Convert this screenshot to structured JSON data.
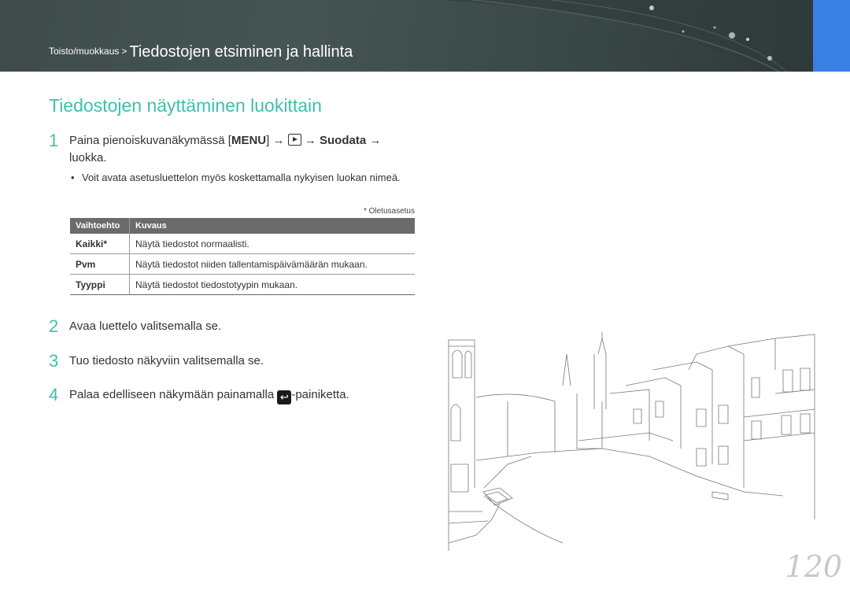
{
  "header": {
    "breadcrumb_parent": "Toisto/muokkaus",
    "breadcrumb_separator": ">",
    "breadcrumb_current": "Tiedostojen etsiminen ja hallinta"
  },
  "section_title": "Tiedostojen näyttäminen luokittain",
  "step1": {
    "number": "1",
    "text_before": "Paina pienoiskuvanäkymässä [",
    "menu_key": "MENU",
    "text_after_key": "] → ",
    "arrow": " → ",
    "bold_item": "Suodata",
    "text_end": " → luokka.",
    "play_icon": "play-icon"
  },
  "bullet": {
    "symbol": "•",
    "text": "Voit avata asetusluettelon myös koskettamalla nykyisen luokan nimeä."
  },
  "default_note": "* Oletusasetus",
  "options_table": {
    "headers": [
      "Vaihtoehto",
      "Kuvaus"
    ],
    "rows": [
      {
        "option": "Kaikki*",
        "description": "Näytä tiedostot normaalisti."
      },
      {
        "option": "Pvm",
        "description": "Näytä tiedostot niiden tallentamispäivämäärän mukaan."
      },
      {
        "option": "Tyyppi",
        "description": "Näytä tiedostot tiedostotyypin mukaan."
      }
    ]
  },
  "step2": {
    "number": "2",
    "text": "Avaa luettelo valitsemalla se."
  },
  "step3": {
    "number": "3",
    "text": "Tuo tiedosto näkyviin valitsemalla se."
  },
  "step4": {
    "number": "4",
    "text_before": "Palaa edelliseen näkymään painamalla ",
    "text_after": "-painiketta.",
    "icon": "back-icon",
    "icon_glyph": "↩"
  },
  "page_number": "120",
  "colors": {
    "accent": "#3fbfa9",
    "header": "#404c4c",
    "tab": "#3a7fe4",
    "table_header": "#6b6b6b"
  }
}
